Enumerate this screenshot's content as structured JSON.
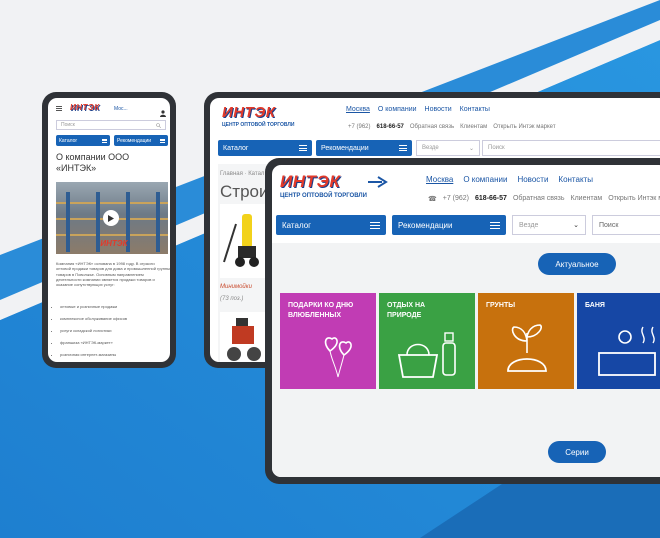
{
  "colors": {
    "accent": "#1763b6",
    "logo_red": "#e23a2a",
    "tile_pink": "#c13cb4",
    "tile_green": "#3aa144",
    "tile_orange": "#c7710d",
    "tile_blue": "#1647a5"
  },
  "logo": {
    "word": "ИНТЭК",
    "subtitle": "ЦЕНТР ОПТОВОЙ ТОРГОВЛИ"
  },
  "nav": {
    "city": "Москва",
    "about": "О компании",
    "news": "Новости",
    "contacts": "Контакты"
  },
  "contact": {
    "phone_prefix": "+7 (962)",
    "phone_main": "618-66-57",
    "feedback": "Обратная связь",
    "clients": "Клиентам",
    "market": "Открыть Интэк маркет"
  },
  "buttons": {
    "catalog": "Каталог",
    "recommend": "Рекомендации"
  },
  "search": {
    "scope": "Везде",
    "placeholder": "Поиск"
  },
  "desktop": {
    "actual": "Актуальное",
    "series": "Серии",
    "tiles": [
      {
        "title": "ПОДАРКИ КО ДНЮ ВЛЮБЛЕННЫХ",
        "icon": "balloon-hearts-icon"
      },
      {
        "title": "ОТДЫХ НА ПРИРОДЕ",
        "icon": "picnic-basket-icon"
      },
      {
        "title": "ГРУНТЫ",
        "icon": "sprout-icon"
      },
      {
        "title": "БАНЯ",
        "icon": "sauna-icon"
      }
    ]
  },
  "tablet": {
    "breadcrumb_home": "Главная",
    "breadcrumb_cat": "Катал",
    "page_title": "Строит",
    "product_label": "Минимойки",
    "product_count": "(73 поз.)"
  },
  "phone": {
    "city": "Мос...",
    "search_placeholder": "Поиск",
    "catalog": "Каталог",
    "recommend": "Рекомендации",
    "title": "О компании ООО «ИНТЭК»",
    "body": "Компания «ИНТЭК» основана в 1998 году. В отрасли оптовой продажи товаров для дома и промышленной группы товаров в Поволжье. Основным направлением деятельности компании является продажи товаров и оказание сопутствующих услуг:",
    "bullets": [
      "оптовые и розничные продажи",
      "комплексное обслуживание офисов",
      "услуги складской логистики",
      "франшиза «ИНТЭК-маркет»",
      "розничная интернет-магазины"
    ]
  }
}
